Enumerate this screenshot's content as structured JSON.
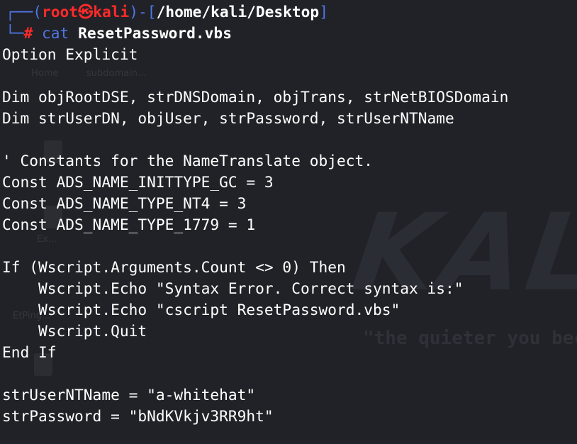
{
  "wallpaper": {
    "logo_text": "KALI",
    "tagline": "\"the quieter you become\"",
    "labels": [
      "Home",
      "subdomain...",
      "Ex...",
      "EtPing..."
    ]
  },
  "prompt": {
    "box_open": "┌──(",
    "user": "root",
    "at_symbol": "㉿",
    "host": "kali",
    "sep": ")-[",
    "path": "/home/kali/Desktop",
    "box_close": "]",
    "corner": "└─",
    "hash": "#",
    "command": "cat",
    "argument": "ResetPassword.vbs"
  },
  "output": [
    "Option Explicit",
    "",
    "Dim objRootDSE, strDNSDomain, objTrans, strNetBIOSDomain",
    "Dim strUserDN, objUser, strPassword, strUserNTName",
    "",
    "' Constants for the NameTranslate object.",
    "Const ADS_NAME_INITTYPE_GC = 3",
    "Const ADS_NAME_TYPE_NT4 = 3",
    "Const ADS_NAME_TYPE_1779 = 1",
    "",
    "If (Wscript.Arguments.Count <> 0) Then",
    "    Wscript.Echo \"Syntax Error. Correct syntax is:\"",
    "    Wscript.Echo \"cscript ResetPassword.vbs\"",
    "    Wscript.Quit",
    "End If",
    "",
    "strUserNTName = \"a-whitehat\"",
    "strPassword = \"bNdKVkjv3RR9ht\""
  ],
  "colors": {
    "background": "#212227",
    "prompt_blue": "#4f76e8",
    "prompt_red": "#ff2a2a",
    "text": "#ffffff"
  }
}
